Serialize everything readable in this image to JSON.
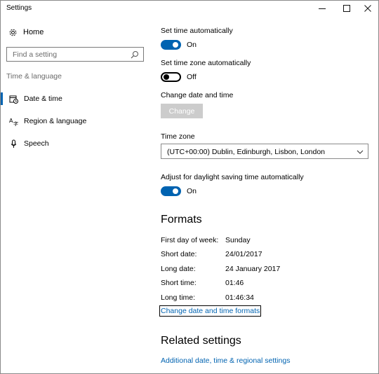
{
  "window": {
    "title": "Settings",
    "minimize": "minimize",
    "maximize": "maximize",
    "close": "close"
  },
  "sidebar": {
    "home": {
      "label": "Home",
      "icon": "gear-icon"
    },
    "search": {
      "placeholder": "Find a setting",
      "icon": "search-icon"
    },
    "section": "Time & language",
    "items": [
      {
        "label": "Date & time",
        "icon": "calendar-clock-icon",
        "active": true
      },
      {
        "label": "Region & language",
        "icon": "region-language-icon",
        "active": false
      },
      {
        "label": "Speech",
        "icon": "microphone-icon",
        "active": false
      }
    ]
  },
  "main": {
    "set_time_auto": {
      "label": "Set time automatically",
      "state": "On"
    },
    "set_tz_auto": {
      "label": "Set time zone automatically",
      "state": "Off"
    },
    "change_dt": {
      "label": "Change date and time",
      "button": "Change"
    },
    "time_zone": {
      "label": "Time zone",
      "value": "(UTC+00:00) Dublin, Edinburgh, Lisbon, London"
    },
    "dst": {
      "label": "Adjust for daylight saving time automatically",
      "state": "On"
    },
    "formats": {
      "heading": "Formats",
      "rows": [
        {
          "label": "First day of week:",
          "value": "Sunday"
        },
        {
          "label": "Short date:",
          "value": "24/01/2017"
        },
        {
          "label": "Long date:",
          "value": "24 January 2017"
        },
        {
          "label": "Short time:",
          "value": "01:46"
        },
        {
          "label": "Long time:",
          "value": "01:46:34"
        }
      ],
      "change_link": "Change date and time formats"
    },
    "related": {
      "heading": "Related settings",
      "link": "Additional date, time & regional settings"
    }
  },
  "colors": {
    "accent": "#0063b1",
    "disabled_button": "#cccccc",
    "muted_text": "#6b6b6b"
  }
}
